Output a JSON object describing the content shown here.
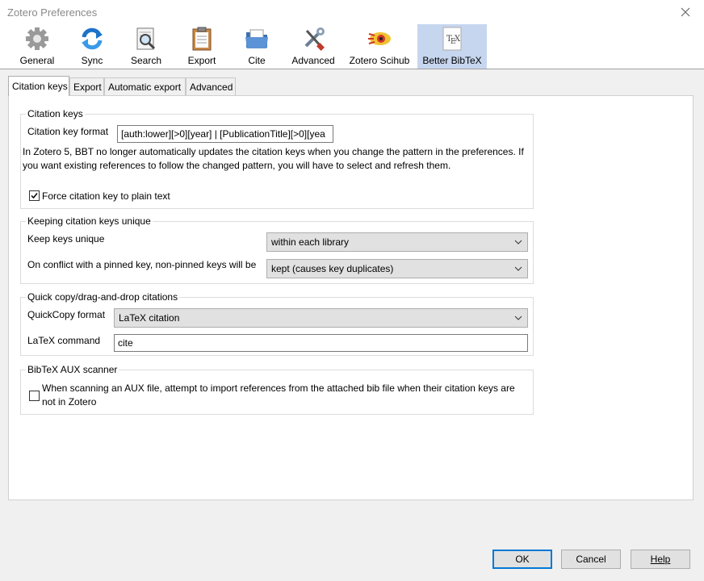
{
  "window": {
    "title": "Zotero Preferences"
  },
  "toolbar": {
    "items": [
      {
        "label": "General",
        "icon": "gear-icon"
      },
      {
        "label": "Sync",
        "icon": "sync-icon"
      },
      {
        "label": "Search",
        "icon": "search-icon"
      },
      {
        "label": "Export",
        "icon": "clipboard-icon"
      },
      {
        "label": "Cite",
        "icon": "folder-icon"
      },
      {
        "label": "Advanced",
        "icon": "tools-icon"
      },
      {
        "label": "Zotero Scihub",
        "icon": "scihub-icon"
      },
      {
        "label": "Better BibTeX",
        "icon": "tex-icon",
        "active": true
      }
    ]
  },
  "tabs": [
    {
      "label": "Citation keys",
      "active": true
    },
    {
      "label": "Export"
    },
    {
      "label": "Automatic export"
    },
    {
      "label": "Advanced"
    }
  ],
  "citation_keys": {
    "title": "Citation keys",
    "format_label": "Citation key format",
    "format_value": "[auth:lower][>0][year] | [PublicationTitle][>0][yea",
    "info": "In Zotero 5, BBT no longer automatically updates the citation keys when you change the pattern in the preferences. If you want existing references to follow the changed pattern, you will have to select and refresh them.",
    "force_plain_label": "Force citation key to plain text",
    "force_plain_checked": true
  },
  "unique": {
    "title": "Keeping citation keys unique",
    "keep_label": "Keep keys unique",
    "keep_value": "within each library",
    "conflict_label": "On conflict with a pinned key, non-pinned keys will be",
    "conflict_value": "kept (causes key duplicates)"
  },
  "quickcopy": {
    "title": "Quick copy/drag-and-drop citations",
    "format_label": "QuickCopy format",
    "format_value": "LaTeX citation",
    "command_label": "LaTeX command",
    "command_value": "cite"
  },
  "aux": {
    "title": "BibTeX AUX scanner",
    "import_label": "When scanning an AUX file, attempt to import references from the attached bib file when their citation keys are not in Zotero",
    "import_checked": false
  },
  "buttons": {
    "ok": "OK",
    "cancel": "Cancel",
    "help": "Help"
  },
  "colors": {
    "accent": "#0078d7",
    "active_toolbar": "#c7d6ef"
  }
}
